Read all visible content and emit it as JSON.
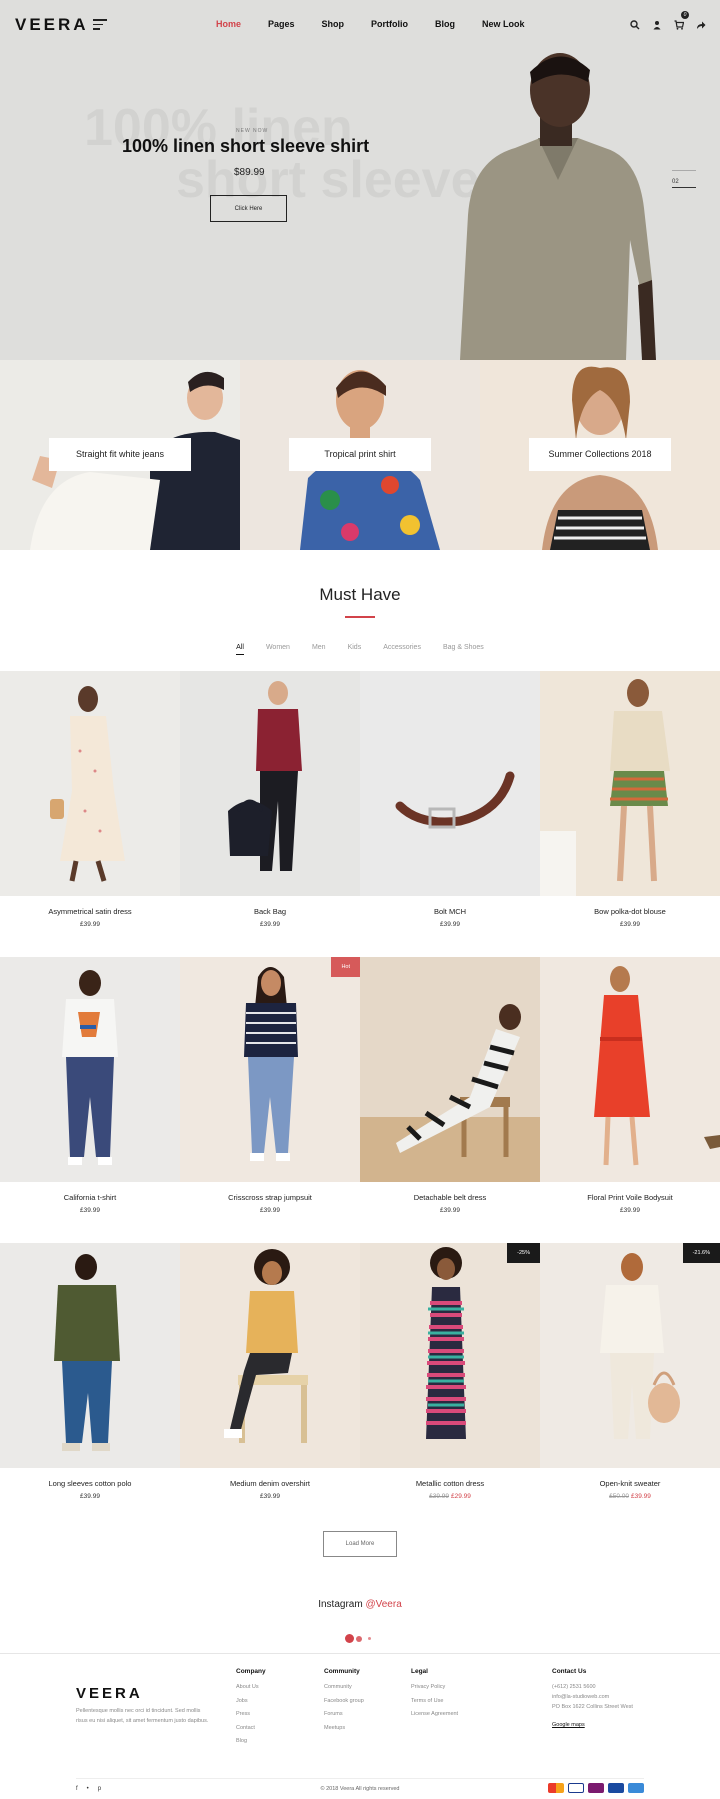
{
  "header": {
    "logo": "VEERA",
    "nav": [
      "Home",
      "Pages",
      "Shop",
      "Portfolio",
      "Blog",
      "New Look"
    ],
    "cart_count": "0"
  },
  "hero": {
    "ghost_line1": "100% linen",
    "ghost_line2": "short sleeve shirt",
    "eyebrow": "NEW NOW",
    "title": "100% linen short sleeve shirt",
    "price": "$89.99",
    "button": "Click Here",
    "slide_number": "02"
  },
  "categories": [
    "Straight fit white jeans",
    "Tropical print shirt",
    "Summer Collections 2018"
  ],
  "must_have": {
    "title": "Must Have",
    "filters": [
      "All",
      "Women",
      "Men",
      "Kids",
      "Accessories",
      "Bag & Shoes"
    ]
  },
  "products": [
    {
      "name": "Asymmetrical satin dress",
      "price": "£39.99"
    },
    {
      "name": "Back Bag",
      "price": "£39.99"
    },
    {
      "name": "Bolt MCH",
      "price": "£39.99"
    },
    {
      "name": "Bow polka-dot blouse",
      "price": "£39.99"
    },
    {
      "name": "California t-shirt",
      "price": "£39.99"
    },
    {
      "name": "Crisscross strap jumpsuit",
      "price": "£39.99",
      "tag": "Hot"
    },
    {
      "name": "Detachable belt dress",
      "price": "£39.99"
    },
    {
      "name": "Floral Print Voile Bodysuit",
      "price": "£39.99"
    },
    {
      "name": "Long sleeves cotton polo",
      "price": "£39.99"
    },
    {
      "name": "Medium denim overshirt",
      "price": "£39.99"
    },
    {
      "name": "Metallic cotton dress",
      "old_price": "£39.99",
      "price": "£29.99",
      "tag": "-25%"
    },
    {
      "name": "Open-knit sweater",
      "old_price": "£50.00",
      "price": "£39.99",
      "tag": "-21.6%"
    }
  ],
  "load_more": "Load More",
  "instagram": {
    "label": "Instagram",
    "handle": "@Veera"
  },
  "footer": {
    "logo": "VEERA",
    "description": "Pellentesque mollis nec orci id tincidunt. Sed mollis risus eu nisi aliquet, sit amet fermentum justo dapibus.",
    "company": {
      "title": "Company",
      "links": [
        "About Us",
        "Jobs",
        "Press",
        "Contact",
        "Blog"
      ]
    },
    "community": {
      "title": "Community",
      "links": [
        "Community",
        "Facebook group",
        "Forums",
        "Meetups"
      ]
    },
    "legal": {
      "title": "Legal",
      "links": [
        "Privacy Policy",
        "Terms of Use",
        "License Agreement"
      ]
    },
    "contact": {
      "title": "Contact Us",
      "lines": [
        "(+612) 2531 5600",
        "info@la-studioweb.com",
        "PO Box 1622 Collins Street West"
      ],
      "map_link": "Google maps"
    },
    "copyright": "© 2018 Veera All rights reserved",
    "social_icons": [
      "facebook-icon",
      "twitter-icon",
      "pinterest-icon"
    ],
    "payment_icons": [
      "mastercard-icon",
      "visa-icon",
      "skrill-icon",
      "paypal-icon",
      "amex-icon"
    ]
  },
  "colors": {
    "accent": "#d2434a",
    "hero_bg": "#dededc",
    "dark": "#222222"
  }
}
